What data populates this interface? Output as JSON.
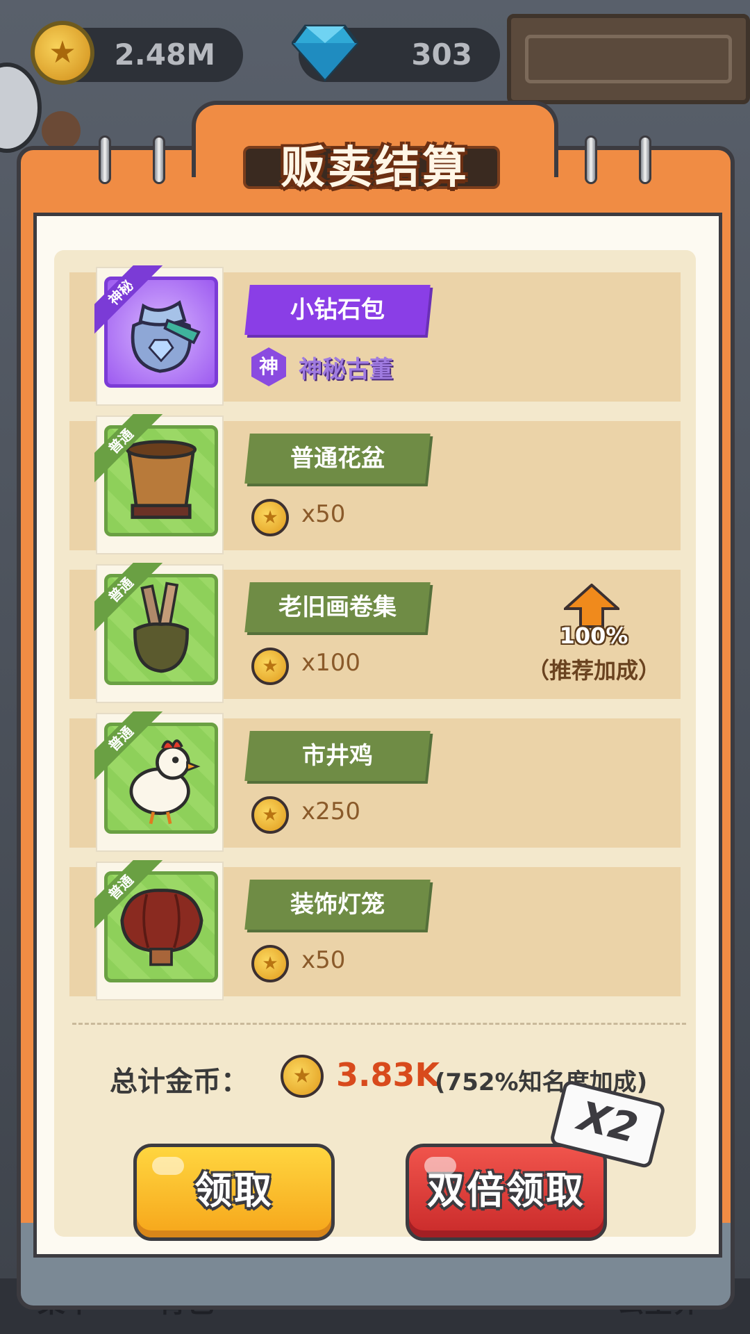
{
  "currency": {
    "coins": "2.48M",
    "gems": "303"
  },
  "modal": {
    "title": "贩卖结算",
    "items": [
      {
        "name": "小钻石包",
        "tag": "神秘",
        "badge": "神",
        "subtitle": "神秘古董",
        "type": "mystic"
      },
      {
        "name": "普通花盆",
        "tag": "普通",
        "reward": "x50",
        "type": "common"
      },
      {
        "name": "老旧画卷集",
        "tag": "普通",
        "reward": "x100",
        "type": "common",
        "bonus_pct": "100%",
        "bonus_note": "（推荐加成）"
      },
      {
        "name": "市井鸡",
        "tag": "普通",
        "reward": "x250",
        "type": "common"
      },
      {
        "name": "装饰灯笼",
        "tag": "普通",
        "reward": "x50",
        "type": "common"
      }
    ],
    "total_label": "总计金币：",
    "total_value": "3.83K",
    "total_bonus": "(752%知名度加成)",
    "claim_label": "领取",
    "double_label": "双倍领取",
    "x2_label": "X2"
  },
  "bottom_nav": {
    "left1": "菜单",
    "left2": "背包",
    "right": "公室界"
  },
  "colors": {
    "frame_orange": "#f08c44",
    "common_green": "#6f8c45",
    "mystic_purple": "#8a3ee6",
    "claim_yellow": "#f6a51a",
    "double_red": "#c92a2a",
    "total_red": "#d84a1c"
  }
}
